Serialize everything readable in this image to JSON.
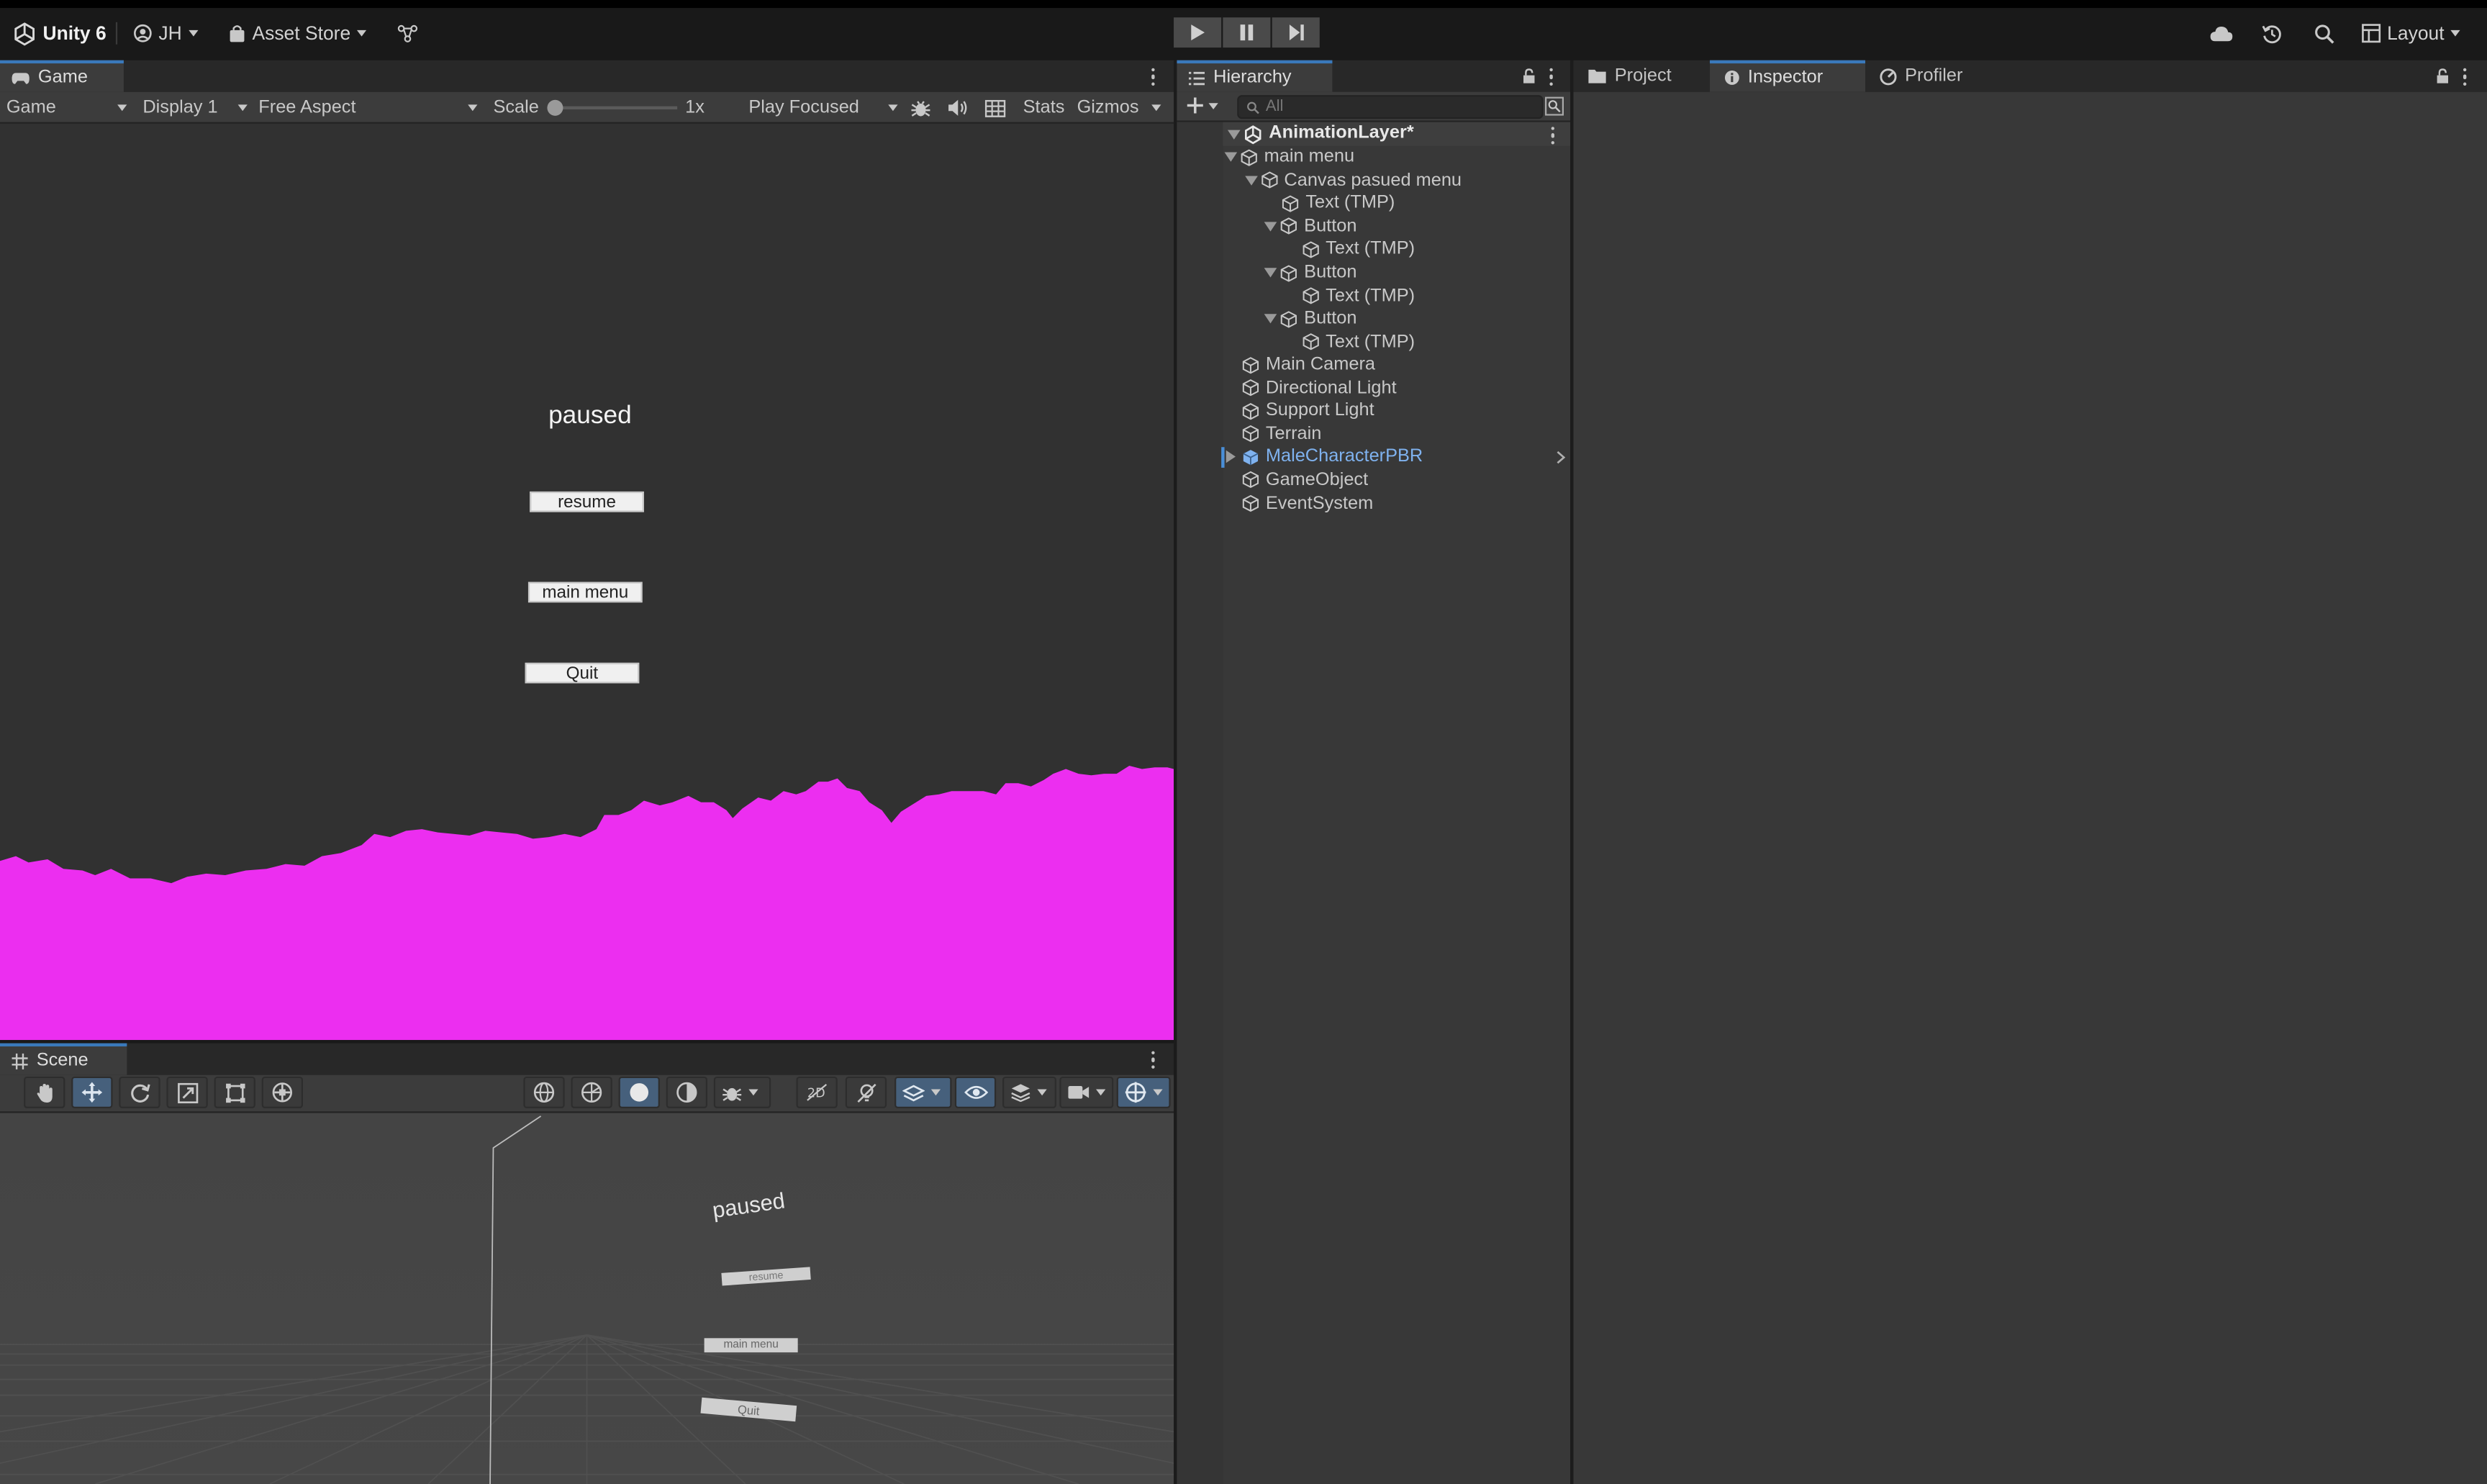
{
  "topbar": {
    "app_name": "Unity 6",
    "account": "JH",
    "asset_store": "Asset Store",
    "layout": "Layout"
  },
  "game_panel": {
    "tab_label": "Game",
    "toolbar": {
      "mode": "Game",
      "display": "Display 1",
      "aspect": "Free Aspect",
      "scale_label": "Scale",
      "scale_value": "1x",
      "play_mode": "Play Focused",
      "stats": "Stats",
      "gizmos": "Gizmos"
    },
    "view": {
      "title": "paused",
      "buttons": [
        "resume",
        "main menu",
        "Quit"
      ],
      "terrain_color": "#ec2ef0"
    }
  },
  "scene_panel": {
    "tab_label": "Scene",
    "view": {
      "title": "paused",
      "buttons": [
        "resume",
        "main menu",
        "Quit"
      ]
    }
  },
  "hierarchy": {
    "tab_label": "Hierarchy",
    "search_placeholder": "All",
    "scene_name": "AnimationLayer*",
    "items": [
      {
        "label": "main menu",
        "depth": 1,
        "expanded": true
      },
      {
        "label": "Canvas pasued menu",
        "depth": 2,
        "expanded": true
      },
      {
        "label": "Text (TMP)",
        "depth": 3
      },
      {
        "label": "Button",
        "depth": 3,
        "expanded": true
      },
      {
        "label": "Text (TMP)",
        "depth": 4
      },
      {
        "label": "Button",
        "depth": 3,
        "expanded": true
      },
      {
        "label": "Text (TMP)",
        "depth": 4
      },
      {
        "label": "Button",
        "depth": 3,
        "expanded": true
      },
      {
        "label": "Text (TMP)",
        "depth": 4
      },
      {
        "label": "Main Camera",
        "depth": 1
      },
      {
        "label": "Directional Light",
        "depth": 1
      },
      {
        "label": "Support Light",
        "depth": 1
      },
      {
        "label": "Terrain",
        "depth": 1
      },
      {
        "label": "MaleCharacterPBR",
        "depth": 1,
        "collapsed": true,
        "prefab": true
      },
      {
        "label": "GameObject",
        "depth": 1
      },
      {
        "label": "EventSystem",
        "depth": 1
      }
    ]
  },
  "right_tabs": {
    "project": "Project",
    "inspector": "Inspector",
    "profiler": "Profiler"
  },
  "colors": {
    "accent": "#3a79bb",
    "prefab": "#7fb2ef",
    "panel": "#383838",
    "topbar": "#191919"
  }
}
